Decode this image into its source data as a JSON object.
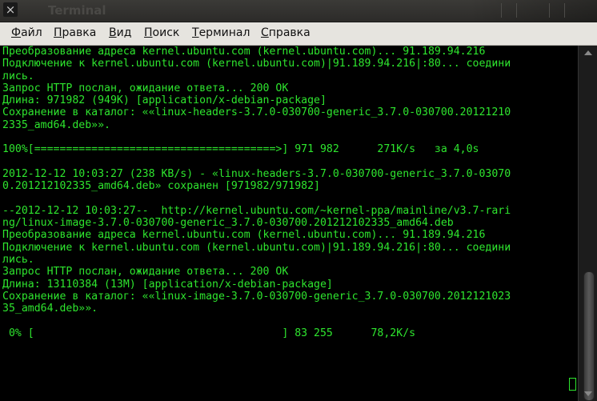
{
  "window": {
    "title": "Terminal"
  },
  "menu": [
    {
      "id": "file",
      "first": "Ф",
      "rest": "айл"
    },
    {
      "id": "edit",
      "first": "П",
      "rest": "равка"
    },
    {
      "id": "view",
      "first": "В",
      "rest": "ид"
    },
    {
      "id": "search",
      "first": "П",
      "rest": "оиск"
    },
    {
      "id": "terminal",
      "first": "Т",
      "rest": "ерминал"
    },
    {
      "id": "help",
      "first": "С",
      "rest": "правка"
    }
  ],
  "terminal": {
    "lines": [
      "Преобразование адреса kernel.ubuntu.com (kernel.ubuntu.com)... 91.189.94.216",
      "Подключение к kernel.ubuntu.com (kernel.ubuntu.com)|91.189.94.216|:80... соедини",
      "лись.",
      "Запрос HTTP послан, ожидание ответа... 200 OK",
      "Длина: 971982 (949K) [application/x-debian-package]",
      "Сохранение в каталог: ««linux-headers-3.7.0-030700-generic_3.7.0-030700.20121210",
      "2335_amd64.deb»».",
      "",
      "100%[======================================>] 971 982      271K/s   за 4,0s",
      "",
      "2012-12-12 10:03:27 (238 KB/s) - «linux-headers-3.7.0-030700-generic_3.7.0-03070",
      "0.201212102335_amd64.deb» сохранен [971982/971982]",
      "",
      "--2012-12-12 10:03:27--  http://kernel.ubuntu.com/~kernel-ppa/mainline/v3.7-rari",
      "ng/linux-image-3.7.0-030700-generic_3.7.0-030700.201212102335_amd64.deb",
      "Преобразование адреса kernel.ubuntu.com (kernel.ubuntu.com)... 91.189.94.216",
      "Подключение к kernel.ubuntu.com (kernel.ubuntu.com)|91.189.94.216|:80... соедини",
      "лись.",
      "Запрос HTTP послан, ожидание ответа... 200 OK",
      "Длина: 13110384 (13M) [application/x-debian-package]",
      "Сохранение в каталог: ««linux-image-3.7.0-030700-generic_3.7.0-030700.2012121023",
      "35_amd64.deb»».",
      "",
      " 0% [                                       ] 83 255      78,2K/s"
    ]
  },
  "colors": {
    "terminal_fg": "#2ee52e",
    "terminal_bg": "#000000",
    "menubar_bg": "#e6e4df"
  }
}
